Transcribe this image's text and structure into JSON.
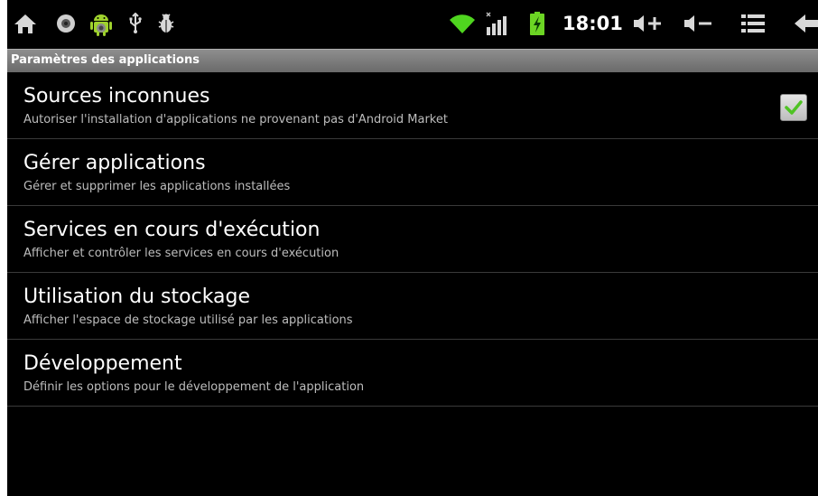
{
  "status_bar": {
    "time": "18:01",
    "left_icons": [
      "home-icon",
      "webcam-icon",
      "android-debug-icon",
      "usb-icon",
      "bug-icon"
    ],
    "right_icons": [
      "wifi-icon",
      "signal-icon",
      "battery-charging-icon",
      "volume-up-icon",
      "volume-down-icon",
      "menu-icon",
      "back-icon"
    ]
  },
  "title_bar": {
    "title": "Paramètres des applications"
  },
  "settings": {
    "items": [
      {
        "title": "Sources inconnues",
        "summary": "Autoriser l'installation d'applications ne provenant pas d'Android Market",
        "checked": true
      },
      {
        "title": "Gérer applications",
        "summary": "Gérer et supprimer les applications installées"
      },
      {
        "title": "Services en cours d'exécution",
        "summary": "Afficher et contrôler les services en cours d'exécution"
      },
      {
        "title": "Utilisation du stockage",
        "summary": "Afficher l'espace de stockage utilisé par les applications"
      },
      {
        "title": "Développement",
        "summary": "Définir les options pour le développement de l'application"
      }
    ]
  },
  "colors": {
    "background": "#000000",
    "accent_check": "#4fc324",
    "wifi": "#4fd51f",
    "battery": "#6cd524"
  }
}
